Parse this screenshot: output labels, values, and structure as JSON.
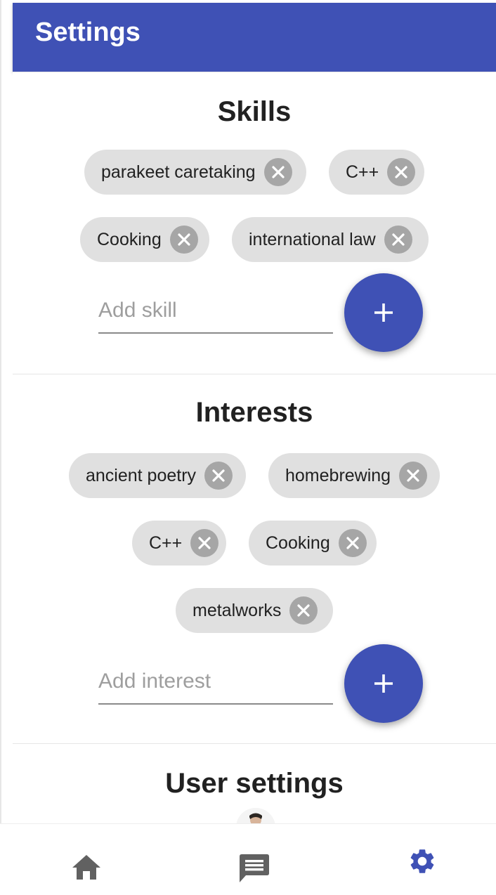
{
  "app_bar": {
    "title": "Settings"
  },
  "skills": {
    "title": "Skills",
    "chips": [
      "parakeet caretaking",
      "C++",
      "Cooking",
      "international law"
    ],
    "add_placeholder": "Add skill",
    "add_value": ""
  },
  "interests": {
    "title": "Interests",
    "chips": [
      "ancient poetry",
      "homebrewing",
      "C++",
      "Cooking",
      "metalworks"
    ],
    "add_placeholder": "Add interest",
    "add_value": ""
  },
  "user_settings": {
    "title": "User settings"
  },
  "bottom_nav": {
    "items": [
      {
        "icon": "home-icon",
        "active": false
      },
      {
        "icon": "chat-icon",
        "active": false
      },
      {
        "icon": "gear-icon",
        "active": true
      }
    ]
  },
  "colors": {
    "primary": "#3f51b5",
    "chip_background": "#e0e0e0",
    "chip_remove": "#a6a6a6",
    "inactive_icon": "#616161",
    "text": "#212121",
    "placeholder": "#9e9e9e"
  }
}
